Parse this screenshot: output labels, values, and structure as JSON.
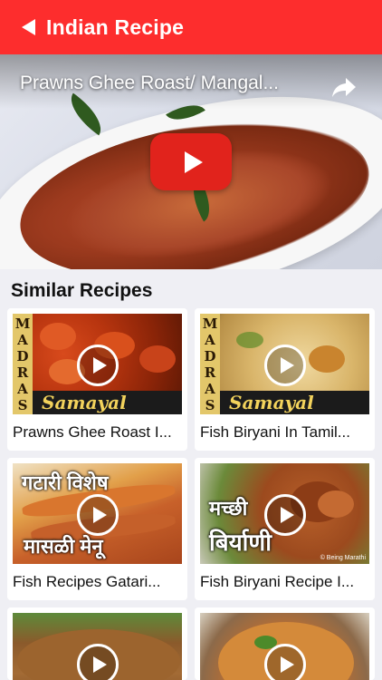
{
  "nav": {
    "back_icon": "chevron-left-icon",
    "title": "Indian Recipe"
  },
  "video": {
    "title": "Prawns Ghee Roast/ Mangal...",
    "share_icon": "share-icon",
    "play_icon": "youtube-play-icon"
  },
  "section": {
    "title": "Similar Recipes"
  },
  "cards": [
    {
      "label": "Prawns Ghee Roast I...",
      "channel_letters": [
        "M",
        "A",
        "D",
        "R",
        "A",
        "S"
      ],
      "channel_word": "Samayal"
    },
    {
      "label": "Fish Biryani In Tamil...",
      "channel_letters": [
        "M",
        "A",
        "D",
        "R",
        "A",
        "S"
      ],
      "channel_word": "Samayal"
    },
    {
      "label": "Fish Recipes Gatari...",
      "overlay_top": "गटारी विशेष",
      "overlay_bottom": "मासळी मेनू"
    },
    {
      "label": "Fish Biryani Recipe I...",
      "overlay_top": "मच्छी",
      "overlay_bottom": "बिर्याणी",
      "watermark": "© Being Marathi"
    },
    {
      "label": ""
    },
    {
      "label": ""
    }
  ],
  "colors": {
    "nav_bg": "#fd2d2d",
    "youtube_red": "#e1231c",
    "page_bg": "#efeff4"
  }
}
